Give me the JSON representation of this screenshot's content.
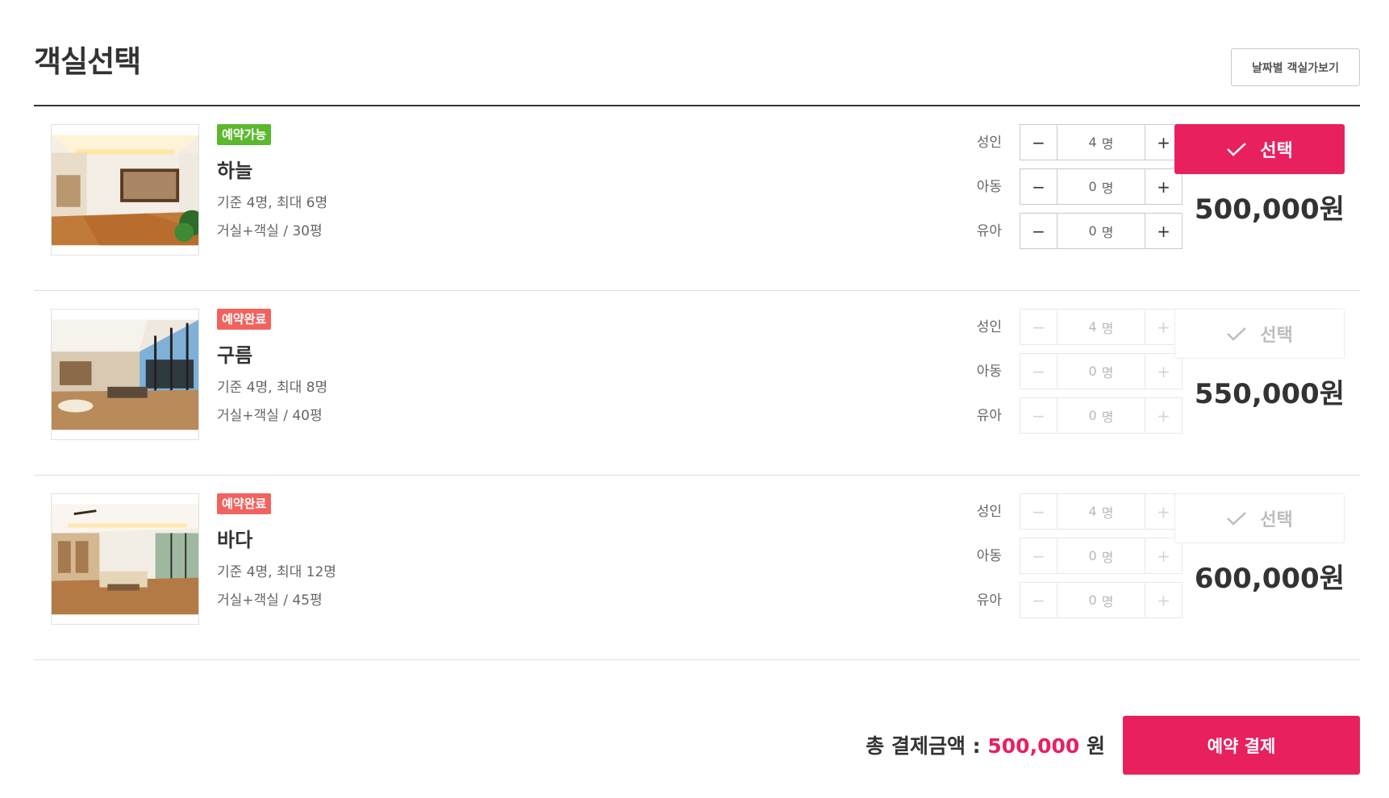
{
  "header": {
    "title": "객실선택",
    "date_view_button": "날짜별 객실가보기"
  },
  "rooms": [
    {
      "status": "예약가능",
      "name": "하늘",
      "capacity": "기준 4명, 최대 6명",
      "area": "거실+객실 / 30평",
      "guests": [
        {
          "label": "성인",
          "count": "4",
          "unit": "명"
        },
        {
          "label": "아동",
          "count": "0",
          "unit": "명"
        },
        {
          "label": "유아",
          "count": "0",
          "unit": "명"
        }
      ],
      "select_label": "선택",
      "price": "500,000원"
    },
    {
      "status": "예약완료",
      "name": "구름",
      "capacity": "기준 4명, 최대 8명",
      "area": "거실+객실 / 40평",
      "guests": [
        {
          "label": "성인",
          "count": "4",
          "unit": "명"
        },
        {
          "label": "아동",
          "count": "0",
          "unit": "명"
        },
        {
          "label": "유아",
          "count": "0",
          "unit": "명"
        }
      ],
      "select_label": "선택",
      "price": "550,000원"
    },
    {
      "status": "예약완료",
      "name": "바다",
      "capacity": "기준 4명, 최대 12명",
      "area": "거실+객실 / 45평",
      "guests": [
        {
          "label": "성인",
          "count": "4",
          "unit": "명"
        },
        {
          "label": "아동",
          "count": "0",
          "unit": "명"
        },
        {
          "label": "유아",
          "count": "0",
          "unit": "명"
        }
      ],
      "select_label": "선택",
      "price": "600,000원"
    }
  ],
  "stepper_symbols": {
    "minus": "−",
    "plus": "+"
  },
  "footer": {
    "total_label": "총 결제금액 :",
    "total_amount": "500,000",
    "total_unit": "원",
    "pay_button": "예약 결제"
  },
  "colors": {
    "accent": "#e8215e",
    "available": "#5cb82d",
    "booked": "#f1635e"
  },
  "icons": [
    "check-icon",
    "minus-icon",
    "plus-icon"
  ]
}
